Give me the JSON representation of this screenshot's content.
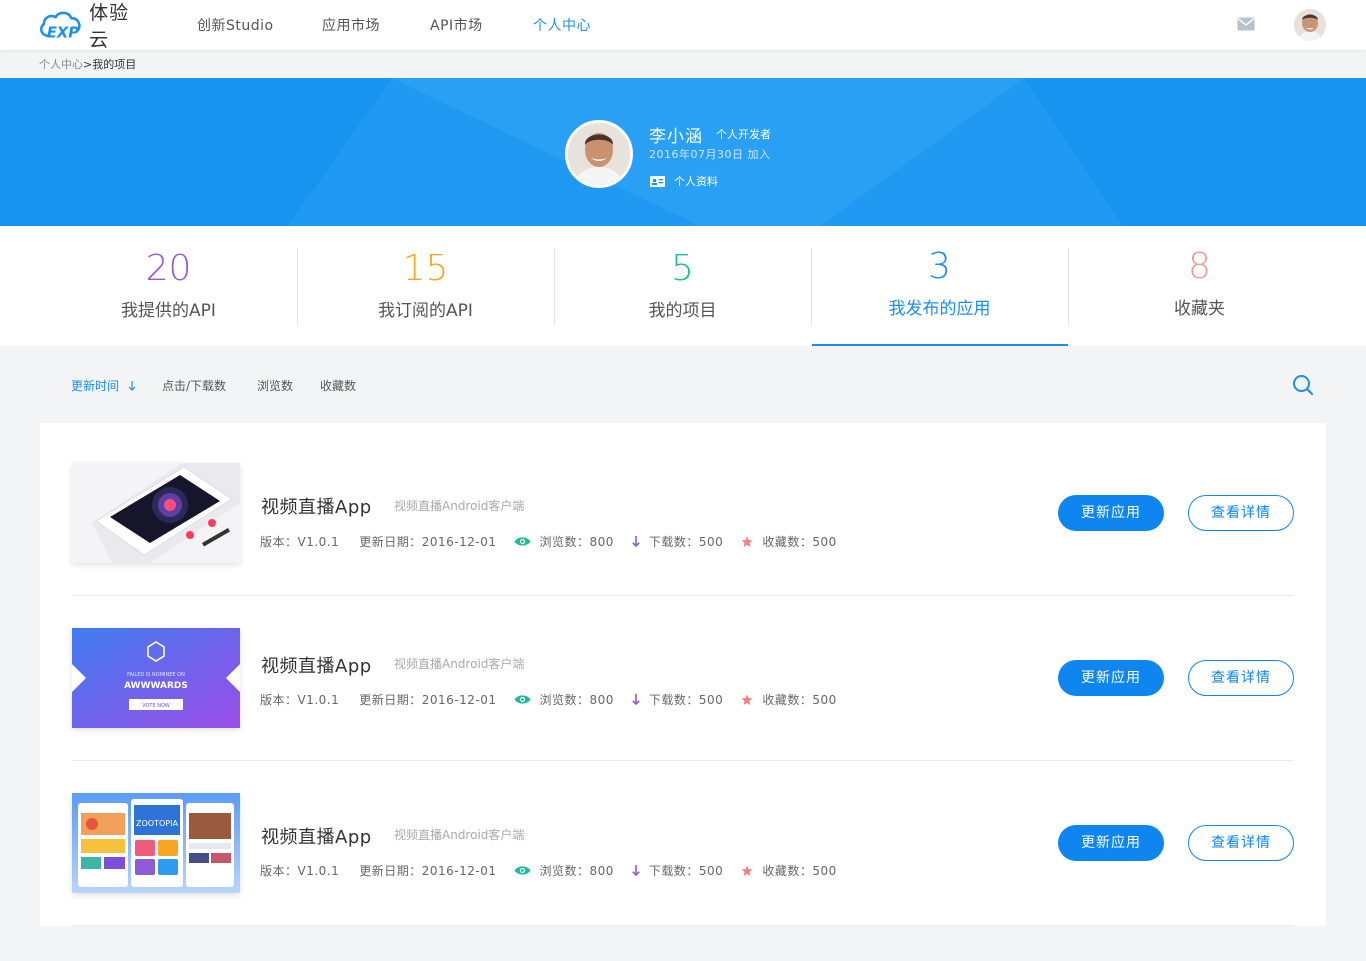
{
  "brand": {
    "name": "体验云"
  },
  "nav": {
    "items": [
      {
        "label": "创新Studio"
      },
      {
        "label": "应用市场"
      },
      {
        "label": "API市场"
      },
      {
        "label": "个人中心",
        "active": true
      }
    ]
  },
  "breadcrumb": {
    "parent": "个人中心",
    "separator": ">",
    "current": "我的项目"
  },
  "profile": {
    "name": "李小涵",
    "role": "个人开发者",
    "joined": "2016年07月30日 加入",
    "link_label": "个人资料"
  },
  "stats": [
    {
      "value": "20",
      "label": "我提供的API",
      "color": "#9b59d0"
    },
    {
      "value": "15",
      "label": "我订阅的API",
      "color": "#f5a623"
    },
    {
      "value": "5",
      "label": "我的项目",
      "color": "#1bbc9b"
    },
    {
      "value": "3",
      "label": "我发布的应用",
      "color": "#1a8ff2",
      "active": true
    },
    {
      "value": "8",
      "label": "收藏夹",
      "color": "#f19b91"
    }
  ],
  "filters": [
    {
      "label": "更新时间",
      "active": true,
      "sort": "desc"
    },
    {
      "label": "点击/下载数"
    },
    {
      "label": "浏览数"
    },
    {
      "label": "收藏数"
    }
  ],
  "apps": [
    {
      "title": "视频直播App",
      "subtitle": "视频直播Android客户端",
      "version": "版本：V1.0.1",
      "updated": "更新日期：2016-12-01",
      "views": "浏览数：800",
      "downloads": "下载数：500",
      "favorites": "收藏数：500",
      "update_label": "更新应用",
      "detail_label": "查看详情",
      "thumb": "phone-astrology"
    },
    {
      "title": "视频直播App",
      "subtitle": "视频直播Android客户端",
      "version": "版本：V1.0.1",
      "updated": "更新日期：2016-12-01",
      "views": "浏览数：800",
      "downloads": "下载数：500",
      "favorites": "收藏数：500",
      "update_label": "更新应用",
      "detail_label": "查看详情",
      "thumb": "awwwards-banner",
      "thumb_text": {
        "line1": "FAILED IS NOMINEE ON",
        "line2": "AWWWARDS",
        "button": "VOTE NOW"
      }
    },
    {
      "title": "视频直播App",
      "subtitle": "视频直播Android客户端",
      "version": "版本：V1.0.1",
      "updated": "更新日期：2016-12-01",
      "views": "浏览数：800",
      "downloads": "下载数：500",
      "favorites": "收藏数：500",
      "update_label": "更新应用",
      "detail_label": "查看详情",
      "thumb": "app-screens",
      "thumb_text": {
        "label": "ZOOTOPIA"
      }
    }
  ],
  "colors": {
    "primary": "#0f86ef",
    "banner": "#1694f0",
    "eye": "#1bbc9b",
    "download": "#8e5bd6",
    "star": "#f3807a"
  }
}
